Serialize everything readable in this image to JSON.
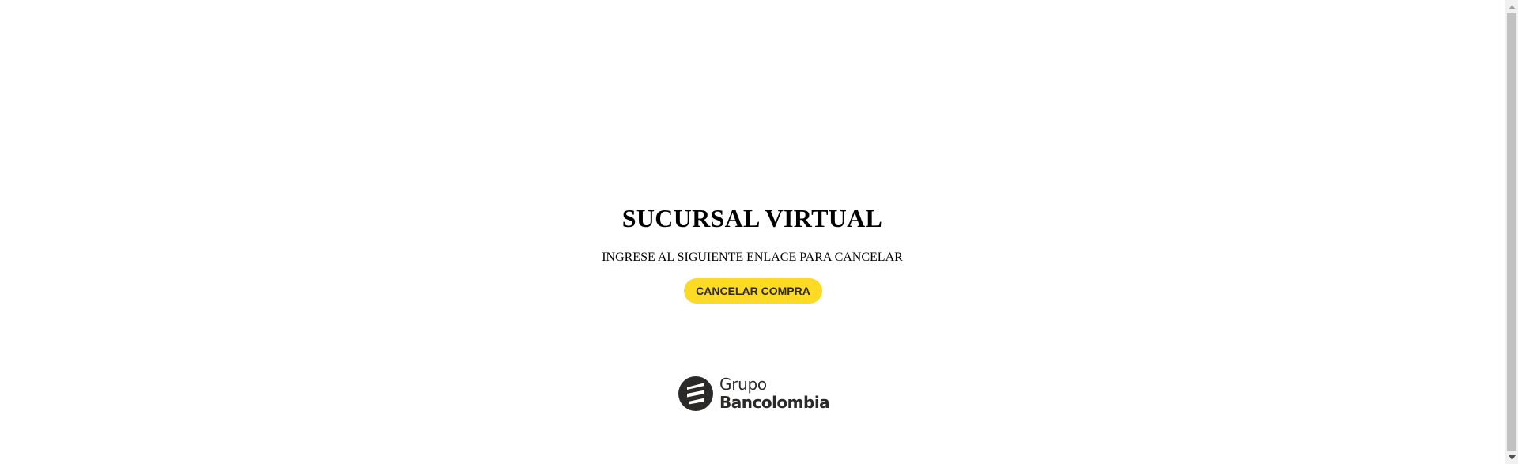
{
  "main": {
    "title": "SUCURSAL VIRTUAL",
    "subtitle": "INGRESE AL SIGUIENTE ENLACE PARA CANCELAR",
    "cancel_button_label": "CANCELAR COMPRA"
  },
  "footer": {
    "logo_line1": "Grupo",
    "logo_line2": "Bancolombia",
    "logo_icon": "bancolombia-logo-icon"
  },
  "colors": {
    "button_bg": "#fdda24",
    "button_text": "#2c2a29",
    "logo_dark": "#2c2a29",
    "background": "#ffffff"
  },
  "scrollbar": {
    "up_icon": "scroll-up-arrow-icon",
    "down_icon": "scroll-down-arrow-icon"
  }
}
